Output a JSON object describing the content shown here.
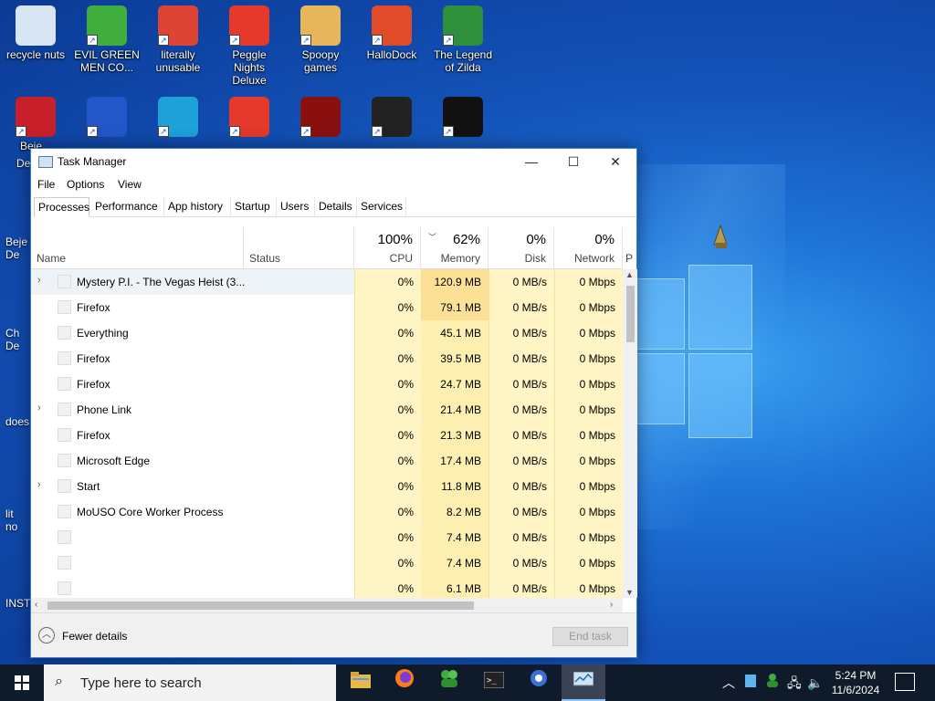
{
  "desktop": {
    "icons_top": [
      {
        "label": "recycle nuts",
        "icon": "recycle-bin-icon",
        "color": "#d7e6f2"
      },
      {
        "label": "EVIL GREEN MEN CO...",
        "icon": "green-men-icon",
        "color": "#3fae3f"
      },
      {
        "label": "literally unusable",
        "icon": "chrome-icon",
        "color": "#dd4433"
      },
      {
        "label": "Peggle Nights Deluxe",
        "icon": "peggle-icon",
        "color": "#e4392b"
      },
      {
        "label": "Spoopy games",
        "icon": "folder-icon",
        "color": "#e8b65a"
      },
      {
        "label": "HalloDock",
        "icon": "windows-shield-icon",
        "color": "#e24b2a"
      },
      {
        "label": "The Legend of Zilda",
        "icon": "zilda-icon",
        "color": "#2f8f3a"
      }
    ],
    "icons_row2": [
      {
        "label": "Beje...",
        "icon": "bejeweled-icon",
        "color": "#c8202a"
      },
      {
        "label": "",
        "icon": "mpi-icon",
        "color": "#2356c8"
      },
      {
        "label": "",
        "icon": "edge-icon",
        "color": "#1ea0d8"
      },
      {
        "label": "",
        "icon": "peggle-icon",
        "color": "#e4392b"
      },
      {
        "label": "",
        "icon": "flash-icon",
        "color": "#8a1010"
      },
      {
        "label": "",
        "icon": "app-icon",
        "color": "#222222"
      },
      {
        "label": "",
        "icon": "yashma-icon",
        "color": "#111111"
      }
    ],
    "left_labels": [
      "De",
      "Beje",
      "De",
      "Ch",
      "De",
      "does",
      "lit",
      "no",
      "INST"
    ]
  },
  "window": {
    "title": "Task Manager",
    "minimize": "—",
    "maximize": "☐",
    "close": "✕"
  },
  "menu": [
    "File",
    "Options",
    "View"
  ],
  "tabs": [
    "Processes",
    "Performance",
    "App history",
    "Startup",
    "Users",
    "Details",
    "Services"
  ],
  "columns": {
    "name": "Name",
    "status": "Status",
    "cpu": {
      "pct": "100%",
      "label": "CPU"
    },
    "memory": {
      "pct": "62%",
      "label": "Memory"
    },
    "disk": {
      "pct": "0%",
      "label": "Disk"
    },
    "network": {
      "pct": "0%",
      "label": "Network"
    },
    "power": "P"
  },
  "processes": [
    {
      "name": "Mystery P.I. - The Vegas Heist (3...",
      "expand": "›",
      "cpu": "0%",
      "memory": "120.9 MB",
      "disk": "0 MB/s",
      "network": "0 Mbps"
    },
    {
      "name": "Firefox",
      "expand": "",
      "cpu": "0%",
      "memory": "79.1 MB",
      "disk": "0 MB/s",
      "network": "0 Mbps"
    },
    {
      "name": "Everything",
      "expand": "",
      "cpu": "0%",
      "memory": "45.1 MB",
      "disk": "0 MB/s",
      "network": "0 Mbps"
    },
    {
      "name": "Firefox",
      "expand": "",
      "cpu": "0%",
      "memory": "39.5 MB",
      "disk": "0 MB/s",
      "network": "0 Mbps"
    },
    {
      "name": "Firefox",
      "expand": "",
      "cpu": "0%",
      "memory": "24.7 MB",
      "disk": "0 MB/s",
      "network": "0 Mbps"
    },
    {
      "name": "Phone Link",
      "expand": "›",
      "cpu": "0%",
      "memory": "21.4 MB",
      "disk": "0 MB/s",
      "network": "0 Mbps"
    },
    {
      "name": "Firefox",
      "expand": "",
      "cpu": "0%",
      "memory": "21.3 MB",
      "disk": "0 MB/s",
      "network": "0 Mbps"
    },
    {
      "name": "Microsoft Edge",
      "expand": "",
      "cpu": "0%",
      "memory": "17.4 MB",
      "disk": "0 MB/s",
      "network": "0 Mbps"
    },
    {
      "name": "Start",
      "expand": "›",
      "cpu": "0%",
      "memory": "11.8 MB",
      "disk": "0 MB/s",
      "network": "0 Mbps"
    },
    {
      "name": "MoUSO Core Worker Process",
      "expand": "",
      "cpu": "0%",
      "memory": "8.2 MB",
      "disk": "0 MB/s",
      "network": "0 Mbps"
    },
    {
      "name": "",
      "expand": "",
      "cpu": "0%",
      "memory": "7.4 MB",
      "disk": "0 MB/s",
      "network": "0 Mbps"
    },
    {
      "name": "",
      "expand": "",
      "cpu": "0%",
      "memory": "7.4 MB",
      "disk": "0 MB/s",
      "network": "0 Mbps"
    },
    {
      "name": "",
      "expand": "",
      "cpu": "0%",
      "memory": "6.1 MB",
      "disk": "0 MB/s",
      "network": "0 Mbps"
    }
  ],
  "footer": {
    "fewer_details": "Fewer details",
    "end_task": "End task"
  },
  "taskbar": {
    "search_placeholder": "Type here to search",
    "time": "5:24 PM",
    "date": "11/6/2024",
    "apps": [
      "file-explorer-icon",
      "firefox-icon",
      "green-men-icon",
      "terminal-icon",
      "app-icon",
      "task-manager-icon"
    ]
  }
}
